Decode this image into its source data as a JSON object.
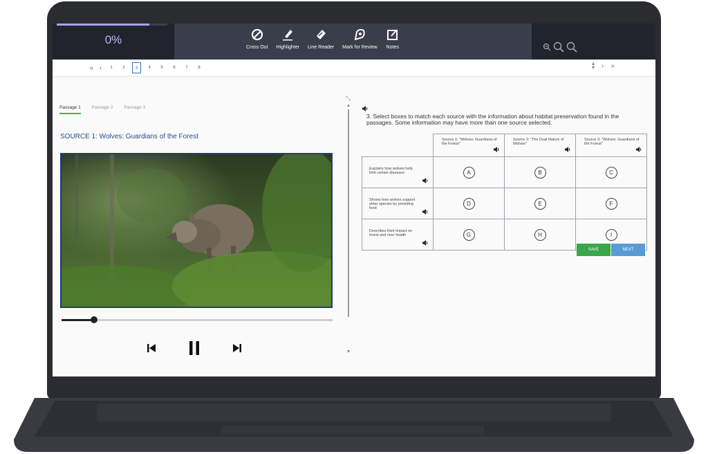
{
  "progress": {
    "text": "0%",
    "fraction": 0.84
  },
  "toolbar": {
    "tools": [
      {
        "label": "Cross Out",
        "icon": "cross-out-icon"
      },
      {
        "label": "Highlighter",
        "icon": "highlighter-icon"
      },
      {
        "label": "Line Reader",
        "icon": "line-reader-icon"
      },
      {
        "label": "Mark for Review",
        "icon": "mark-review-icon"
      },
      {
        "label": "Notes",
        "icon": "notes-icon"
      }
    ],
    "zoom_icons": [
      "zoom-out-icon",
      "zoom-reset-icon",
      "zoom-in-icon"
    ]
  },
  "pager": {
    "pages": [
      "1",
      "2",
      "3",
      "4",
      "5",
      "6",
      "7",
      "8"
    ],
    "current": "3"
  },
  "passages": {
    "tabs": [
      "Passage 1",
      "Passage 2",
      "Passage 3"
    ],
    "active": "Passage 1"
  },
  "source": {
    "title": "SOURCE 1: Wolves: Guardians of the Forest"
  },
  "player": {
    "position_fraction": 0.12
  },
  "question": {
    "text": "3. Select boxes to match each source with the information about habitat preservation found in the passages. Some information may have more than one source selected.",
    "columns": [
      "Source 1: \"Wolves: Guardians of the Forest\"",
      "Source 2: \"The Dual Nature of Wolves\"",
      "Source 3: \"Wolves: Guardians of the Forest\""
    ],
    "rows": [
      {
        "label": "Explains how wolves help limit certain diseases",
        "choices": [
          "A",
          "B",
          "C"
        ]
      },
      {
        "label": "Shows how wolves support other species by providing food",
        "choices": [
          "D",
          "E",
          "F"
        ]
      },
      {
        "label": "Describes their impact on forest and river health",
        "choices": [
          "G",
          "H",
          "I"
        ]
      }
    ]
  },
  "buttons": {
    "save": "SAVE",
    "next": "NEXT"
  },
  "colors": {
    "accent_green": "#3aa54a",
    "accent_blue": "#5b9bd5",
    "topbar": "#3a3d4a",
    "progress": "#a9a4e8"
  }
}
